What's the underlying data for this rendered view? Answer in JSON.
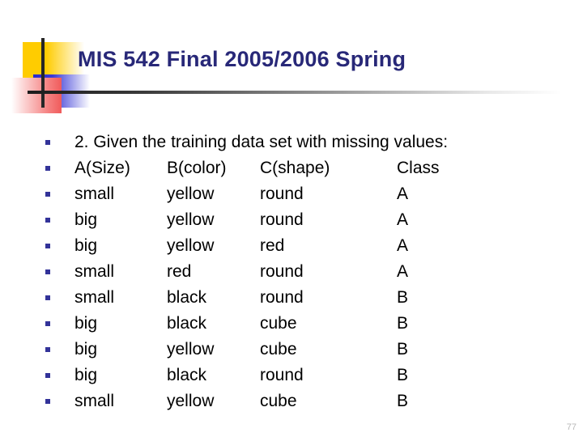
{
  "slide": {
    "title": "MIS 542 Final 2005/2006 Spring",
    "page_number": "77",
    "colors": {
      "title": "#282878",
      "bullet": "#333399",
      "yellow_block": "#FFCC00",
      "blue_block": "#2A2ACC",
      "red_block": "#F05B5B",
      "bar": "#262626",
      "body_text": "#000000",
      "page_number": "#b8b8b8"
    }
  },
  "content": {
    "question": "2. Given the training data set with missing values:",
    "headers": {
      "col1": "A(Size)",
      "col2": "B(color)",
      "col3": "C(shape)",
      "col4": "Class"
    },
    "rows": [
      {
        "col1": "small",
        "col2": "yellow",
        "col3": "round",
        "col4": "A"
      },
      {
        "col1": "big",
        "col2": "yellow",
        "col3": "round",
        "col4": "A"
      },
      {
        "col1": "big",
        "col2": "yellow",
        "col3": "red",
        "col4": "A"
      },
      {
        "col1": "small",
        "col2": "red",
        "col3": "round",
        "col4": "A"
      },
      {
        "col1": "small",
        "col2": "black",
        "col3": "round",
        "col4": "B"
      },
      {
        "col1": "big",
        "col2": "black",
        "col3": "cube",
        "col4": "B"
      },
      {
        "col1": "big",
        "col2": "yellow",
        "col3": "cube",
        "col4": "B"
      },
      {
        "col1": "big",
        "col2": "black",
        "col3": "round",
        "col4": "B"
      },
      {
        "col1": "small",
        "col2": "yellow",
        "col3": "cube",
        "col4": "B"
      }
    ]
  }
}
